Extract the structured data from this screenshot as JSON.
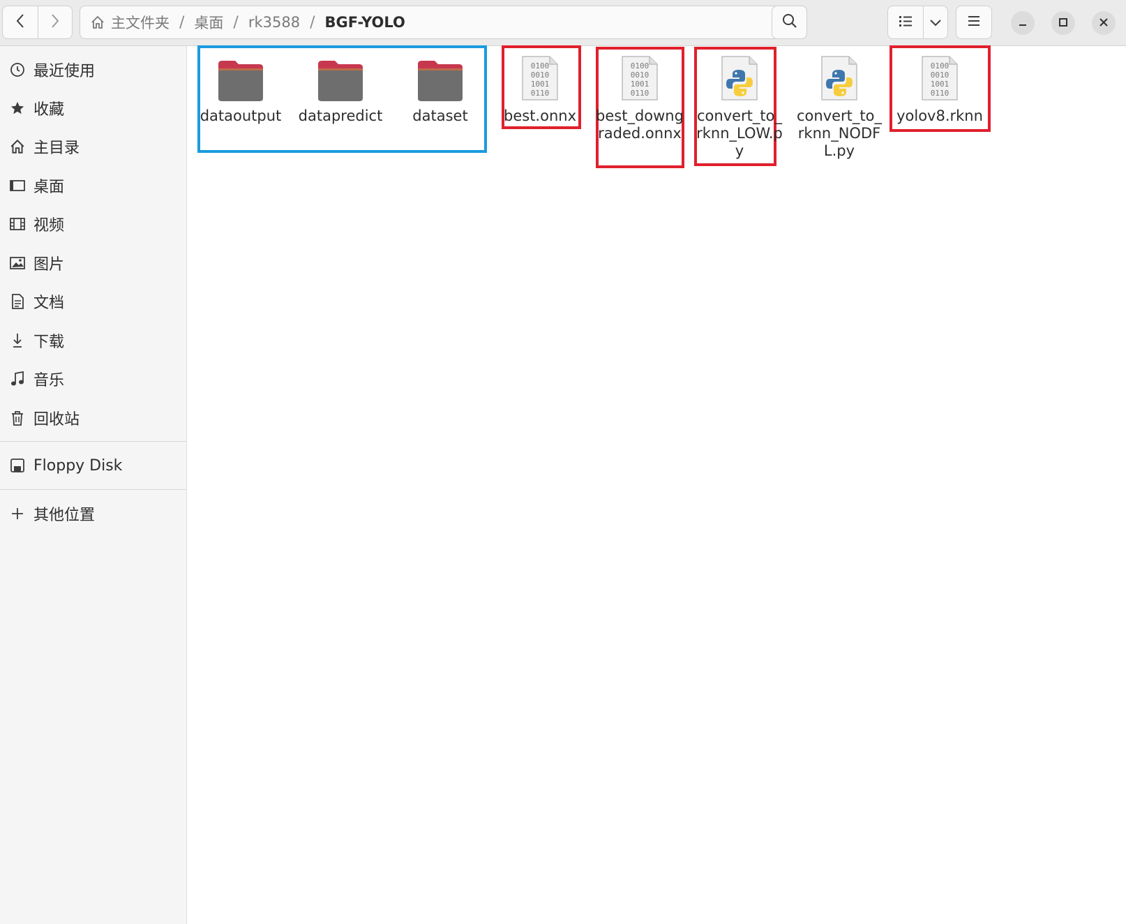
{
  "header": {
    "path": {
      "segments": [
        "主文件夹",
        "桌面",
        "rk3588"
      ],
      "current": "BGF-YOLO",
      "separator": "/"
    },
    "icons": {
      "back": "chevron-left-icon",
      "forward": "chevron-right-icon",
      "home": "home-icon",
      "path_menu": "vertical-dots-icon",
      "search": "search-icon",
      "view_list": "list-view-icon",
      "view_options": "chevron-down-icon",
      "main_menu": "hamburger-menu-icon",
      "minimize": "minimize-icon",
      "maximize": "maximize-icon",
      "close": "close-icon"
    }
  },
  "sidebar": {
    "items": [
      {
        "label": "最近使用",
        "icon": "clock-icon"
      },
      {
        "label": "收藏",
        "icon": "star-icon"
      },
      {
        "label": "主目录",
        "icon": "home-icon"
      },
      {
        "label": "桌面",
        "icon": "desktop-icon"
      },
      {
        "label": "视频",
        "icon": "film-icon"
      },
      {
        "label": "图片",
        "icon": "image-icon"
      },
      {
        "label": "文档",
        "icon": "document-icon"
      },
      {
        "label": "下载",
        "icon": "download-icon"
      },
      {
        "label": "音乐",
        "icon": "music-icon"
      },
      {
        "label": "回收站",
        "icon": "trash-icon"
      }
    ],
    "devices": [
      {
        "label": "Floppy Disk",
        "icon": "floppy-disk-icon"
      }
    ],
    "other": {
      "label": "其他位置",
      "icon": "plus-icon"
    }
  },
  "files": [
    {
      "name": "dataoutput",
      "type": "folder",
      "icon": "folder-icon"
    },
    {
      "name": "datapredict",
      "type": "folder",
      "icon": "folder-icon"
    },
    {
      "name": "dataset",
      "type": "folder",
      "icon": "folder-icon"
    },
    {
      "name": "best.onnx",
      "type": "binary",
      "icon": "binary-file-icon"
    },
    {
      "name": "best_downgraded.onnx",
      "type": "binary",
      "icon": "binary-file-icon"
    },
    {
      "name": "convert_to_rknn_LOW.py",
      "type": "python",
      "icon": "python-file-icon"
    },
    {
      "name": "convert_to_rknn_NODFL.py",
      "type": "python",
      "icon": "python-file-icon"
    },
    {
      "name": "yolov8.rknn",
      "type": "binary",
      "icon": "binary-file-icon"
    }
  ],
  "binary_glyph": [
    "0100",
    "0010",
    "1001",
    "0110"
  ],
  "annotations": {
    "folders_box_color": "#1a9be0",
    "files_box_color": "#e0202c"
  },
  "colors": {
    "folder_top": "#c7384e",
    "folder_body": "#6e6e6e",
    "python_blue": "#3f77ad",
    "python_yellow": "#f6cd3c"
  }
}
